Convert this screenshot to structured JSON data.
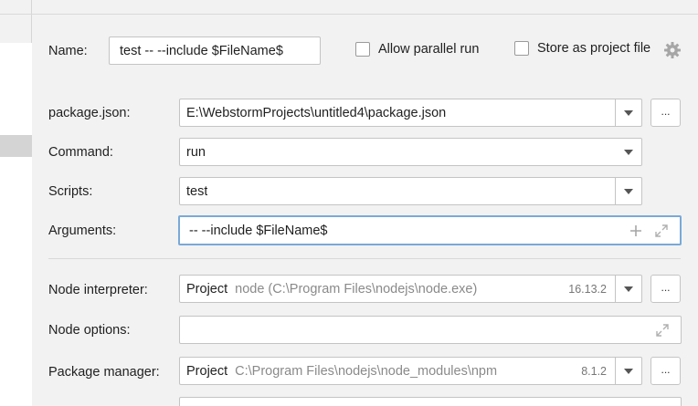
{
  "config": {
    "name_label": "Name:",
    "name_value": "test -- --include $FileName$",
    "allow_parallel_label": "Allow parallel run",
    "store_project_label": "Store as project file"
  },
  "fields": {
    "package_json": {
      "label": "package.json:",
      "value": "E:\\WebstormProjects\\untitled4\\package.json",
      "button": "..."
    },
    "command": {
      "label": "Command:",
      "value": "run"
    },
    "scripts": {
      "label": "Scripts:",
      "value": "test"
    },
    "arguments": {
      "label": "Arguments:",
      "value": "-- --include $FileName$"
    },
    "node_interpreter": {
      "label": "Node interpreter:",
      "value": "Project",
      "detail": "node (C:\\Program Files\\nodejs\\node.exe)",
      "version": "16.13.2",
      "button": "..."
    },
    "node_options": {
      "label": "Node options:",
      "value": ""
    },
    "package_manager": {
      "label": "Package manager:",
      "value": "Project",
      "detail": "C:\\Program Files\\nodejs\\node_modules\\npm",
      "version": "8.1.2",
      "button": "..."
    }
  },
  "icons": {
    "gear": "gear-icon",
    "dropdown": "chevron-down-icon",
    "add": "plus-icon",
    "expand": "expand-icon"
  },
  "colors": {
    "focus_border": "#7aa9d8",
    "selected_row": "#d4d4d4"
  }
}
